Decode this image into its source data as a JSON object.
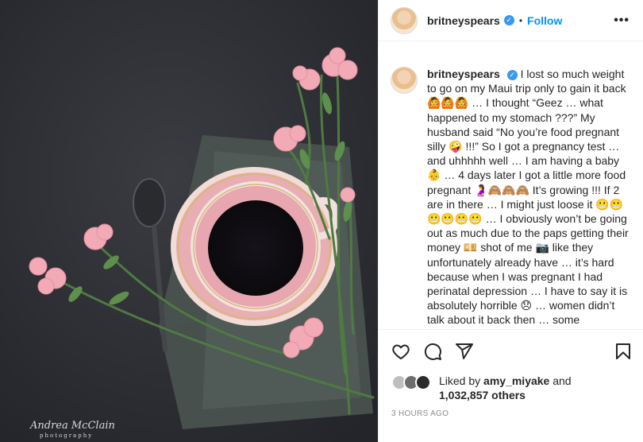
{
  "post": {
    "username": "britneyspears",
    "follow_label": "Follow",
    "separator": "•",
    "more_label": "•••",
    "verified_mark": "✓",
    "caption": "I lost so much weight to go on my Maui trip only to gain it back 🙆🙆🙆 … I thought “Geez … what happened to my stomach ???” My husband said “No you’re food pregnant silly 🤪 !!!” So I got a pregnancy test … and uhhhhh well … I am having a baby 👶 … 4 days later I got a little more food pregnant 🤰🙈🙈🙈 It’s growing !!! If 2 are in there … I might just loose it 😬😬😬😬😬😬 … I obviously won’t be going out as much due to the paps getting their money 💴 shot of me 📷 like they unfortunately already have … it’s hard because when I was pregnant I had perinatal depression … I have to say it is absolutely horrible 😞 … women didn’t talk about it back then … some",
    "likes": {
      "prefix": "Liked by",
      "first_user": "amy_miyake",
      "conjunction": "and",
      "others": "1,032,857 others"
    },
    "timestamp": "3 HOURS AGO"
  },
  "photo": {
    "watermark": "Andrea McClain",
    "watermark_sub": "photography"
  },
  "icons": {
    "like": "heart-icon",
    "comment": "comment-icon",
    "share": "paper-plane-icon",
    "save": "bookmark-icon"
  },
  "colors": {
    "link_blue": "#0095f6",
    "verified_blue": "#3897f0",
    "text": "#262626",
    "muted": "#8e8e8e",
    "background_photo": "#2f3035"
  }
}
